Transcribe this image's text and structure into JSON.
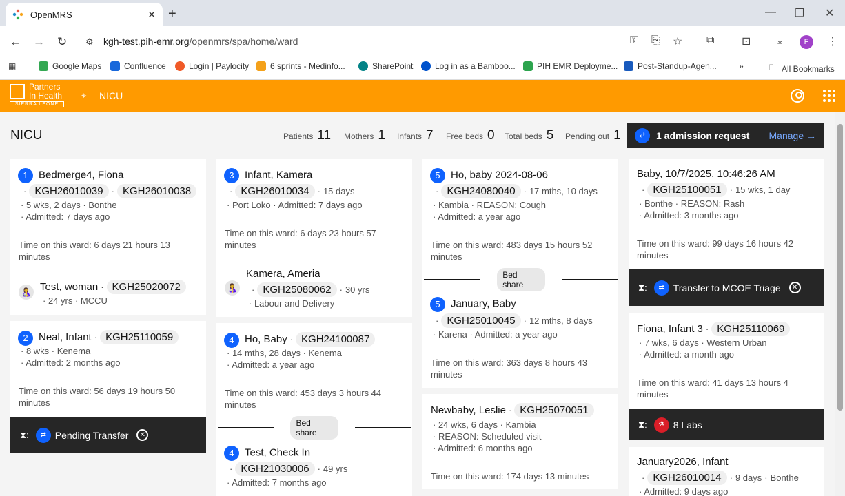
{
  "browser": {
    "tab_title": "OpenMRS",
    "url_host": "kgh-test.pih-emr.org",
    "url_path": "/openmrs/spa/home/ward",
    "profile_initial": "F",
    "bookmarks": [
      "Google Maps",
      "Confluence",
      "Login | Paylocity",
      "6 sprints - Medinfo...",
      "SharePoint",
      "Log in as a Bamboo...",
      "PIH EMR Deployme...",
      "Post-Standup-Agen..."
    ],
    "all_bookmarks": "All Bookmarks"
  },
  "app": {
    "logo_line1": "Partners",
    "logo_line2": "In Health",
    "logo_line3": "SIERRA LEONE",
    "location": "NICU",
    "accent": "#ff9a00"
  },
  "ward": {
    "title": "NICU",
    "stats": [
      {
        "label": "Patients",
        "value": "11"
      },
      {
        "label": "Mothers",
        "value": "1"
      },
      {
        "label": "Infants",
        "value": "7"
      },
      {
        "label": "Free beds",
        "value": "0"
      },
      {
        "label": "Total beds",
        "value": "5"
      },
      {
        "label": "Pending out",
        "value": "1"
      }
    ],
    "admission_request": "1 admission request",
    "manage": "Manage"
  },
  "cards": {
    "c1": {
      "bed": "1",
      "name": "Bedmerge4, Fiona",
      "id1": "KGH26010039",
      "id2": "KGH26010038",
      "line1": "5 wks, 2 days",
      "line1b": "Bonthe",
      "line2": "Admitted: 7 days ago",
      "time": "Time on this ward: 6 days 21 hours 13 minutes",
      "mother_name": "Test, woman",
      "mother_id": "KGH25020072",
      "mother_info": "24 yrs",
      "mother_info2": "MCCU"
    },
    "c2": {
      "bed": "2",
      "name": "Neal, Infant",
      "id": "KGH25110059",
      "line1": "8 wks",
      "line1b": "Kenema",
      "line2": "Admitted: 2 months ago",
      "time": "Time on this ward: 56 days 19 hours 50 minutes",
      "status": "Pending Transfer"
    },
    "c3": {
      "bed": "3",
      "name": "Infant, Kamera",
      "id": "KGH26010034",
      "age": "15 days",
      "line1": "Port Loko",
      "line1b": "Admitted: 7 days ago",
      "time": "Time on this ward: 6 days 23 hours 57 minutes",
      "mother_name": "Kamera, Ameria",
      "mother_id": "KGH25080062",
      "mother_age": "30 yrs",
      "mother_loc": "Labour and Delivery"
    },
    "c4": {
      "bed": "4",
      "name": "Ho, Baby",
      "id": "KGH24100087",
      "line1": "14 mths, 28 days",
      "line1b": "Kenema",
      "line2": "Admitted: a year ago",
      "time": "Time on this ward: 453 days 3 hours 44 minutes",
      "bed_share": "Bed share"
    },
    "c4b": {
      "bed": "4",
      "name": "Test, Check In",
      "id": "KGH21030006",
      "age": "49 yrs",
      "line1": "Admitted: 7 months ago"
    },
    "c5": {
      "bed": "5",
      "name": "Ho, baby 2024-08-06",
      "id": "KGH24080040",
      "age": "17 mths, 10 days",
      "line1": "Kambia",
      "line1b": "REASON: Cough",
      "line2": "Admitted: a year ago",
      "time": "Time on this ward: 483 days 15 hours 52 minutes",
      "bed_share": "Bed share"
    },
    "c5b": {
      "bed": "5",
      "name": "January, Baby",
      "id": "KGH25010045",
      "age": "12 mths, 8 days",
      "line1": "Karena",
      "line1b": "Admitted: a year ago",
      "time": "Time on this ward: 363 days 8 hours 43 minutes"
    },
    "c6": {
      "name": "Newbaby, Leslie",
      "id": "KGH25070051",
      "line1": "24 wks, 6 days",
      "line1b": "Kambia",
      "line2": "REASON: Scheduled visit",
      "line3": "Admitted: 6 months ago",
      "time": "Time on this ward: 174 days 13 minutes"
    },
    "c7": {
      "name": "Baby, 10/7/2025, 10:46:26 AM",
      "id": "KGH25100051",
      "age": "15 wks, 1 day",
      "line1": "Bonthe",
      "line1b": "REASON: Rash",
      "line2": "Admitted: 3 months ago",
      "time": "Time on this ward: 99 days 16 hours 42 minutes",
      "status": "Transfer to MCOE Triage"
    },
    "c8": {
      "name": "Fiona, Infant 3",
      "id": "KGH25110069",
      "line1": "7 wks, 6 days",
      "line1b": "Western Urban",
      "line2": "Admitted: a month ago",
      "time": "Time on this ward: 41 days 13 hours 4 minutes",
      "status": "8 Labs"
    },
    "c9": {
      "name": "January2026, Infant",
      "id": "KGH26010014",
      "age": "9 days",
      "line1b": "Bonthe",
      "line2": "Admitted: 9 days ago"
    }
  }
}
